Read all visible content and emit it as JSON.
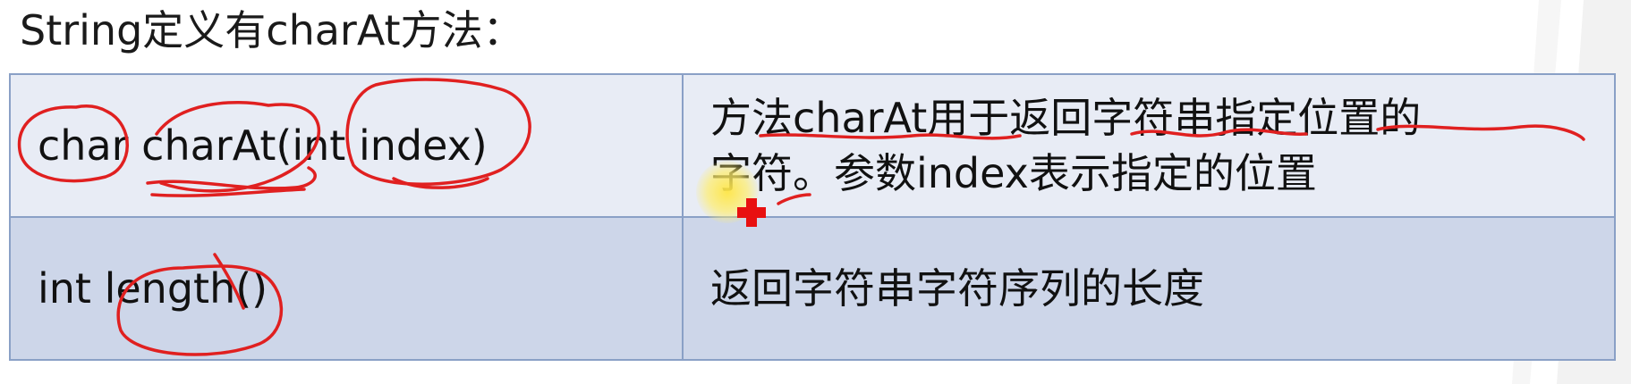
{
  "title": "String定义有charAt方法：",
  "table": {
    "rows": [
      {
        "signature": "char charAt(int index)",
        "description_line1": "方法charAt用于返回字符串指定位置的",
        "description_line2": "字符。参数index表示指定的位置"
      },
      {
        "signature": "int length()",
        "description_line1": "返回字符串字符序列的长度",
        "description_line2": ""
      }
    ]
  },
  "colors": {
    "row1_bg": "#e8ecf5",
    "row2_bg": "#cdd6e9",
    "border": "#8aa0c6",
    "annotation_ink": "#e02020",
    "cursor_highlight": "#ffe646"
  },
  "icons": [
    "cursor-highlight",
    "red-cross-cursor-icon"
  ]
}
